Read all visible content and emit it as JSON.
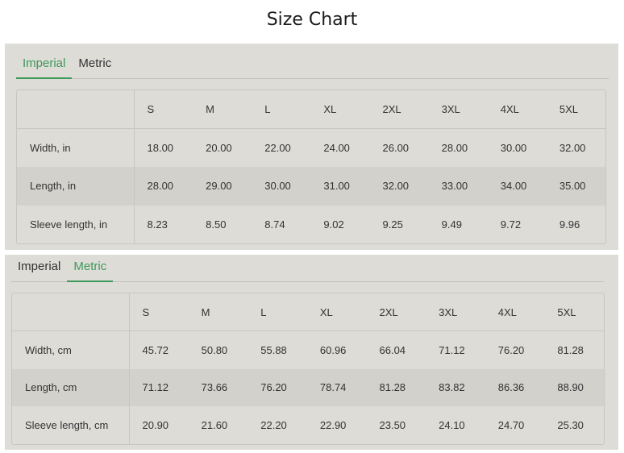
{
  "title": "Size Chart",
  "imperial_panel": {
    "tabs": [
      {
        "label": "Imperial",
        "active": true
      },
      {
        "label": "Metric",
        "active": false
      }
    ],
    "sizes": [
      "S",
      "M",
      "L",
      "XL",
      "2XL",
      "3XL",
      "4XL",
      "5XL"
    ],
    "rows": [
      {
        "label": "Width, in",
        "values": [
          "18.00",
          "20.00",
          "22.00",
          "24.00",
          "26.00",
          "28.00",
          "30.00",
          "32.00"
        ]
      },
      {
        "label": "Length, in",
        "values": [
          "28.00",
          "29.00",
          "30.00",
          "31.00",
          "32.00",
          "33.00",
          "34.00",
          "35.00"
        ]
      },
      {
        "label": "Sleeve length, in",
        "values": [
          "8.23",
          "8.50",
          "8.74",
          "9.02",
          "9.25",
          "9.49",
          "9.72",
          "9.96"
        ]
      }
    ]
  },
  "metric_panel": {
    "tabs": [
      {
        "label": "Imperial",
        "active": false
      },
      {
        "label": "Metric",
        "active": true
      }
    ],
    "sizes": [
      "S",
      "M",
      "L",
      "XL",
      "2XL",
      "3XL",
      "4XL",
      "5XL"
    ],
    "rows": [
      {
        "label": "Width, cm",
        "values": [
          "45.72",
          "50.80",
          "55.88",
          "60.96",
          "66.04",
          "71.12",
          "76.20",
          "81.28"
        ]
      },
      {
        "label": "Length, cm",
        "values": [
          "71.12",
          "73.66",
          "76.20",
          "78.74",
          "81.28",
          "83.82",
          "86.36",
          "88.90"
        ]
      },
      {
        "label": "Sleeve length, cm",
        "values": [
          "20.90",
          "21.60",
          "22.20",
          "22.90",
          "23.50",
          "24.10",
          "24.70",
          "25.30"
        ]
      }
    ]
  },
  "colors": {
    "accent": "#3e9a5a",
    "panel_bg": "#dedcd7",
    "stripe_bg": "#d3d1cc"
  }
}
